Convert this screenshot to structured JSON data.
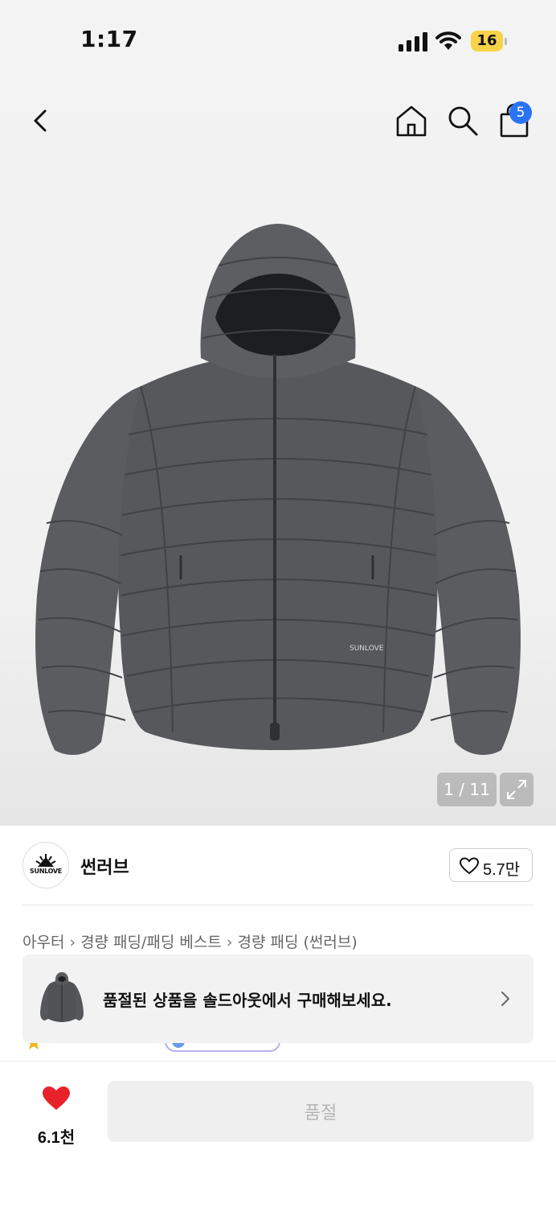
{
  "status_bar": {
    "time": "1:17",
    "battery": "16"
  },
  "header": {
    "cart_count": "5"
  },
  "gallery": {
    "counter": "1 / 11"
  },
  "brand": {
    "name": "썬러브",
    "logo_text": "SUNLOVE",
    "likes": "5.7만"
  },
  "breadcrumb": [
    "아우터",
    "경량 패딩/패딩 베스트",
    "경량 패딩 (썬러브)"
  ],
  "banner": {
    "message": "품절된 상품을 솔드아웃에서 구매해보세요."
  },
  "bottom_bar": {
    "wish_count": "6.1천",
    "buy_label": "품절"
  },
  "colors": {
    "accent": "#2a73f5",
    "heart": "#e8222b",
    "battery": "#f7d34a",
    "jacket": "#55575a"
  }
}
